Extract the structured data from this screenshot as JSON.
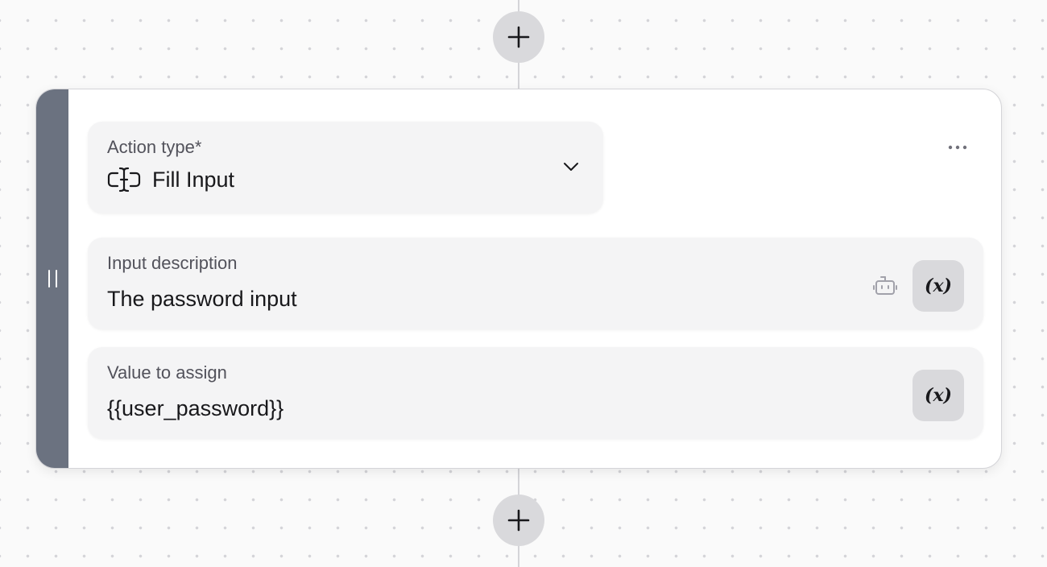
{
  "step": {
    "action_type": {
      "label": "Action type",
      "required_marker": "*",
      "value": "Fill Input",
      "icon": "text-cursor-input-icon"
    },
    "more_menu": {
      "icon": "ellipsis-icon"
    },
    "input_description": {
      "label": "Input description",
      "value": "The password input",
      "ai_icon": "robot-icon",
      "variable_button_label": "(x)"
    },
    "value_to_assign": {
      "label": "Value to assign",
      "value": "{{user_password}}",
      "variable_button_label": "(x)"
    }
  },
  "canvas": {
    "add_step_icon": "plus-icon",
    "accent_handle_color": "#6b7280"
  }
}
